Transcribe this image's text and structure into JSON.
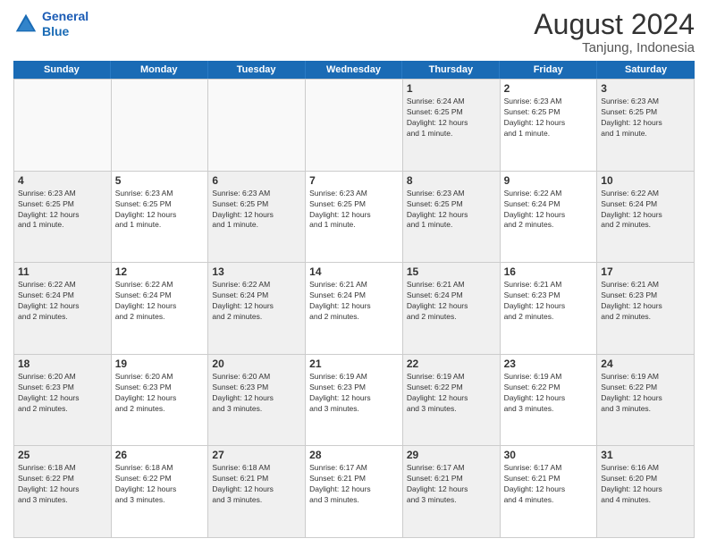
{
  "logo": {
    "line1": "General",
    "line2": "Blue"
  },
  "title": "August 2024",
  "subtitle": "Tanjung, Indonesia",
  "days": [
    "Sunday",
    "Monday",
    "Tuesday",
    "Wednesday",
    "Thursday",
    "Friday",
    "Saturday"
  ],
  "weeks": [
    [
      {
        "day": "",
        "info": ""
      },
      {
        "day": "",
        "info": ""
      },
      {
        "day": "",
        "info": ""
      },
      {
        "day": "",
        "info": ""
      },
      {
        "day": "1",
        "info": "Sunrise: 6:24 AM\nSunset: 6:25 PM\nDaylight: 12 hours\nand 1 minute."
      },
      {
        "day": "2",
        "info": "Sunrise: 6:23 AM\nSunset: 6:25 PM\nDaylight: 12 hours\nand 1 minute."
      },
      {
        "day": "3",
        "info": "Sunrise: 6:23 AM\nSunset: 6:25 PM\nDaylight: 12 hours\nand 1 minute."
      }
    ],
    [
      {
        "day": "4",
        "info": "Sunrise: 6:23 AM\nSunset: 6:25 PM\nDaylight: 12 hours\nand 1 minute."
      },
      {
        "day": "5",
        "info": "Sunrise: 6:23 AM\nSunset: 6:25 PM\nDaylight: 12 hours\nand 1 minute."
      },
      {
        "day": "6",
        "info": "Sunrise: 6:23 AM\nSunset: 6:25 PM\nDaylight: 12 hours\nand 1 minute."
      },
      {
        "day": "7",
        "info": "Sunrise: 6:23 AM\nSunset: 6:25 PM\nDaylight: 12 hours\nand 1 minute."
      },
      {
        "day": "8",
        "info": "Sunrise: 6:23 AM\nSunset: 6:25 PM\nDaylight: 12 hours\nand 1 minute."
      },
      {
        "day": "9",
        "info": "Sunrise: 6:22 AM\nSunset: 6:24 PM\nDaylight: 12 hours\nand 2 minutes."
      },
      {
        "day": "10",
        "info": "Sunrise: 6:22 AM\nSunset: 6:24 PM\nDaylight: 12 hours\nand 2 minutes."
      }
    ],
    [
      {
        "day": "11",
        "info": "Sunrise: 6:22 AM\nSunset: 6:24 PM\nDaylight: 12 hours\nand 2 minutes."
      },
      {
        "day": "12",
        "info": "Sunrise: 6:22 AM\nSunset: 6:24 PM\nDaylight: 12 hours\nand 2 minutes."
      },
      {
        "day": "13",
        "info": "Sunrise: 6:22 AM\nSunset: 6:24 PM\nDaylight: 12 hours\nand 2 minutes."
      },
      {
        "day": "14",
        "info": "Sunrise: 6:21 AM\nSunset: 6:24 PM\nDaylight: 12 hours\nand 2 minutes."
      },
      {
        "day": "15",
        "info": "Sunrise: 6:21 AM\nSunset: 6:24 PM\nDaylight: 12 hours\nand 2 minutes."
      },
      {
        "day": "16",
        "info": "Sunrise: 6:21 AM\nSunset: 6:23 PM\nDaylight: 12 hours\nand 2 minutes."
      },
      {
        "day": "17",
        "info": "Sunrise: 6:21 AM\nSunset: 6:23 PM\nDaylight: 12 hours\nand 2 minutes."
      }
    ],
    [
      {
        "day": "18",
        "info": "Sunrise: 6:20 AM\nSunset: 6:23 PM\nDaylight: 12 hours\nand 2 minutes."
      },
      {
        "day": "19",
        "info": "Sunrise: 6:20 AM\nSunset: 6:23 PM\nDaylight: 12 hours\nand 2 minutes."
      },
      {
        "day": "20",
        "info": "Sunrise: 6:20 AM\nSunset: 6:23 PM\nDaylight: 12 hours\nand 3 minutes."
      },
      {
        "day": "21",
        "info": "Sunrise: 6:19 AM\nSunset: 6:23 PM\nDaylight: 12 hours\nand 3 minutes."
      },
      {
        "day": "22",
        "info": "Sunrise: 6:19 AM\nSunset: 6:22 PM\nDaylight: 12 hours\nand 3 minutes."
      },
      {
        "day": "23",
        "info": "Sunrise: 6:19 AM\nSunset: 6:22 PM\nDaylight: 12 hours\nand 3 minutes."
      },
      {
        "day": "24",
        "info": "Sunrise: 6:19 AM\nSunset: 6:22 PM\nDaylight: 12 hours\nand 3 minutes."
      }
    ],
    [
      {
        "day": "25",
        "info": "Sunrise: 6:18 AM\nSunset: 6:22 PM\nDaylight: 12 hours\nand 3 minutes."
      },
      {
        "day": "26",
        "info": "Sunrise: 6:18 AM\nSunset: 6:22 PM\nDaylight: 12 hours\nand 3 minutes."
      },
      {
        "day": "27",
        "info": "Sunrise: 6:18 AM\nSunset: 6:21 PM\nDaylight: 12 hours\nand 3 minutes."
      },
      {
        "day": "28",
        "info": "Sunrise: 6:17 AM\nSunset: 6:21 PM\nDaylight: 12 hours\nand 3 minutes."
      },
      {
        "day": "29",
        "info": "Sunrise: 6:17 AM\nSunset: 6:21 PM\nDaylight: 12 hours\nand 3 minutes."
      },
      {
        "day": "30",
        "info": "Sunrise: 6:17 AM\nSunset: 6:21 PM\nDaylight: 12 hours\nand 4 minutes."
      },
      {
        "day": "31",
        "info": "Sunrise: 6:16 AM\nSunset: 6:20 PM\nDaylight: 12 hours\nand 4 minutes."
      }
    ]
  ]
}
